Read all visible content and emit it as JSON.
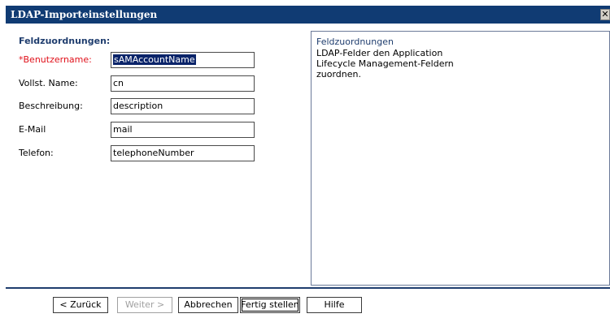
{
  "window": {
    "title": "LDAP-Importeinstellungen",
    "close_glyph": "✕"
  },
  "form": {
    "section_title": "Feldzuordnungen:",
    "fields": [
      {
        "label": "*Benutzername:",
        "value": "sAMAccountName",
        "required": true,
        "selected": true
      },
      {
        "label": "Vollst. Name:",
        "value": "cn"
      },
      {
        "label": "Beschreibung:",
        "value": "description"
      },
      {
        "label": "E-Mail",
        "value": "mail"
      },
      {
        "label": "Telefon:",
        "value": "telephoneNumber"
      }
    ]
  },
  "help": {
    "title": "Feldzuordnungen",
    "text": "LDAP-Felder den Application Lifecycle Management-Feldern zuordnen."
  },
  "buttons": {
    "back": "< Zurück",
    "next": "Weiter >",
    "cancel": "Abbrechen",
    "finish": "Fertig stellen",
    "help": "Hilfe"
  },
  "colors": {
    "titlebar": "#103b73",
    "accent": "#1f3d6e",
    "required": "#e0101a"
  }
}
